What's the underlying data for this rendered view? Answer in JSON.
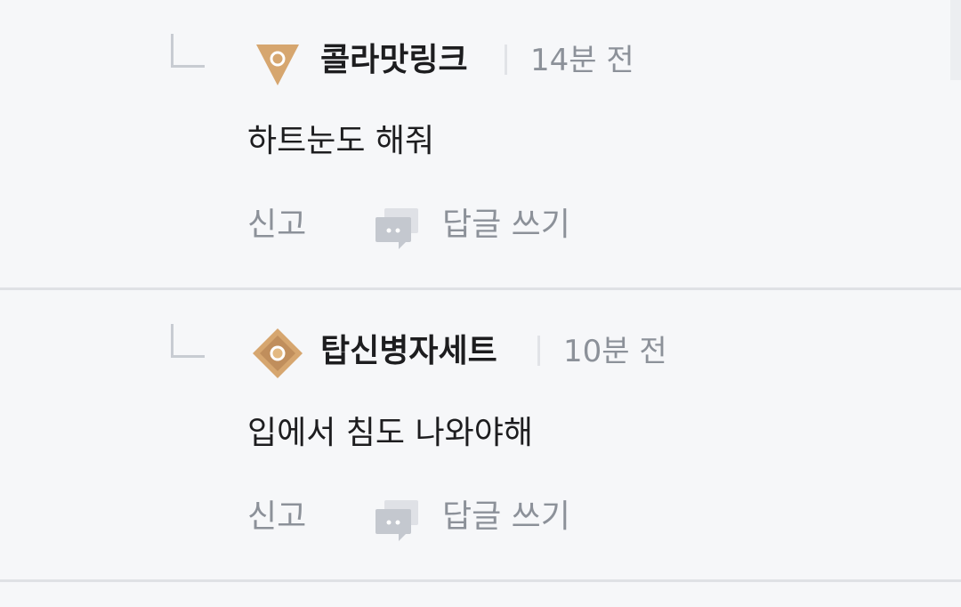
{
  "replies": [
    {
      "level_icon": "bronze-triangle-level-icon",
      "nickname": "콜라맛링크",
      "time": "14분 전",
      "text": "하트눈도 해줘",
      "report_label": "신고",
      "reply_label": "답글 쓰기"
    },
    {
      "level_icon": "bronze-diamond-level-icon",
      "nickname": "탑신병자세트",
      "time": "10분 전",
      "text": "입에서 침도 나와야해",
      "report_label": "신고",
      "reply_label": "답글 쓰기"
    }
  ],
  "colors": {
    "background": "#f6f7f9",
    "divider": "#dfe1e5",
    "muted_text": "#8c9199",
    "primary_text": "#1d1d1f",
    "level_bronze": "#d6a66f"
  }
}
